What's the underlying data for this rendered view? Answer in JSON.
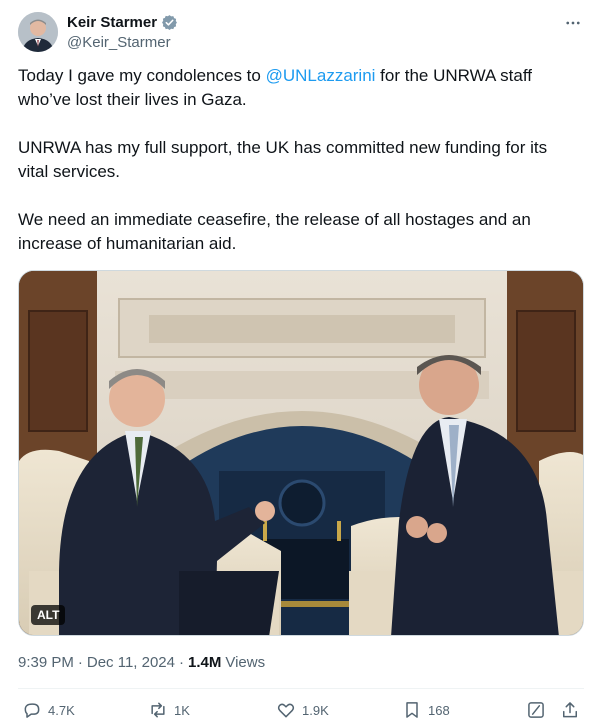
{
  "author": {
    "display_name": "Keir Starmer",
    "handle": "@Keir_Starmer",
    "verified_icon": "verified-badge-icon"
  },
  "tweet": {
    "line1_prefix": "Today I gave my condolences to ",
    "mention": "@UNLazzarini",
    "line1_suffix": " for the UNRWA staff who’ve lost their lives in Gaza.",
    "paragraph2": "UNRWA has my full support, the UK has committed new funding for its vital services.",
    "paragraph3": "We need an immediate ceasefire, the release of all hostages and an increase of humanitarian aid."
  },
  "media": {
    "alt_label": "ALT"
  },
  "meta": {
    "time": "9:39 PM",
    "separator": "·",
    "date": "Dec 11, 2024",
    "views_count": "1.4M",
    "views_label": "Views"
  },
  "actions": {
    "replies": "4.7K",
    "reposts": "1K",
    "likes": "1.9K",
    "bookmarks": "168"
  },
  "colors": {
    "accent": "#1d9bf0",
    "text": "#0f1419",
    "muted": "#536471"
  }
}
